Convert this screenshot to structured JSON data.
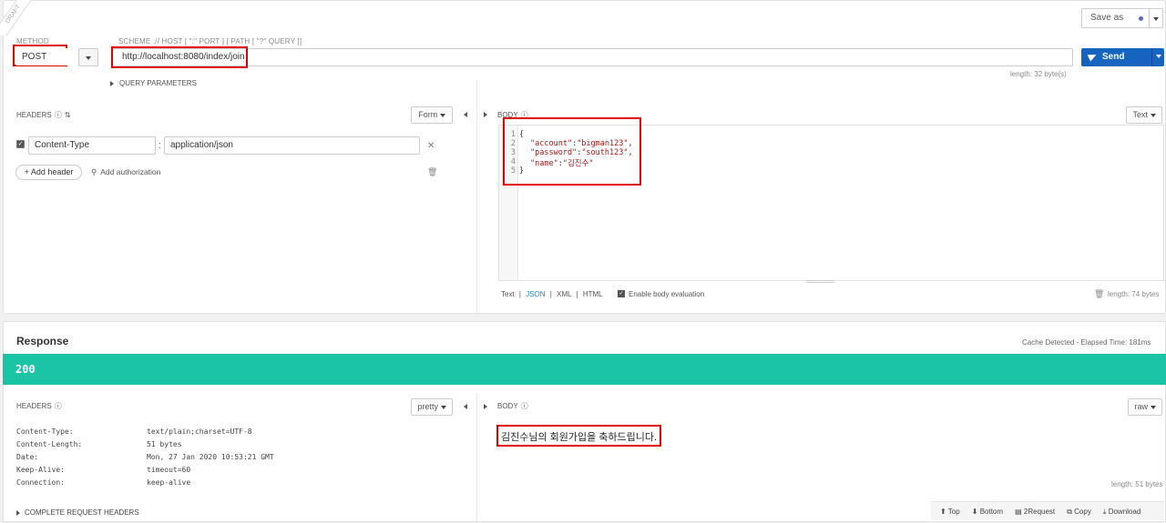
{
  "request": {
    "draft_label": "DRAFT",
    "method_label": "METHOD",
    "method_value": "POST",
    "url_label": "SCHEME :// HOST [ \":\" PORT ] [ PATH [ \"?\" QUERY ]]",
    "url_value": "http://localhost:8080/index/join",
    "url_length": "length: 32 byte(s)",
    "query_params_label": "QUERY PARAMETERS",
    "save_as_label": "Save as",
    "send_label": "Send",
    "headers_title": "HEADERS",
    "headers_mode": "Form",
    "header_name": "Content-Type",
    "header_value": "application/json",
    "header_sep": ":",
    "add_header_label": "+ Add header",
    "add_auth_label": "Add authorization",
    "body_title": "BODY",
    "body_mode": "Text",
    "body_lines": [
      {
        "n": "1",
        "text": "{"
      },
      {
        "n": "2",
        "key": "\"account\"",
        "colon": ":",
        "val": "\"bigman123\"",
        "end": ","
      },
      {
        "n": "3",
        "key": "\"password\"",
        "colon": ":",
        "val": "\"south123\"",
        "end": ","
      },
      {
        "n": "4",
        "key": "\"name\"",
        "colon": ":",
        "val": "\"김진수\"",
        "end": ""
      },
      {
        "n": "5",
        "text": "}"
      }
    ],
    "body_formats": [
      "Text",
      "JSON",
      "XML",
      "HTML"
    ],
    "body_format_active": "JSON",
    "format_sep": "|",
    "body_eval_label": "Enable body evaluation",
    "body_length": "length: 74 bytes"
  },
  "response": {
    "title": "Response",
    "cache_info": "Cache Detected - Elapsed Time: 181ms",
    "status_code": "200",
    "status_color": "#1cc4a6",
    "headers_title": "HEADERS",
    "headers_mode": "pretty",
    "headers": [
      {
        "k": "Content-Type:",
        "v": "text/plain;charset=UTF-8"
      },
      {
        "k": "Content-Length:",
        "v": "51 bytes"
      },
      {
        "k": "Date:",
        "v": "Mon, 27 Jan 2020 10:53:21 GMT"
      },
      {
        "k": "Keep-Alive:",
        "v": "timeout=60"
      },
      {
        "k": "Connection:",
        "v": "keep-alive"
      }
    ],
    "complete_headers_label": "COMPLETE REQUEST HEADERS",
    "body_title": "BODY",
    "body_mode": "raw",
    "body_text": "김진수님의 회원가입을 축하드립니다.",
    "body_length": "length: 51 bytes",
    "toolbar": {
      "top": "Top",
      "bottom": "Bottom",
      "to_request": "2Request",
      "copy": "Copy",
      "download": "Download"
    }
  },
  "colors": {
    "send_blue": "#1565c0",
    "highlight_red": "#e00000",
    "link_blue": "#1e88e5"
  }
}
